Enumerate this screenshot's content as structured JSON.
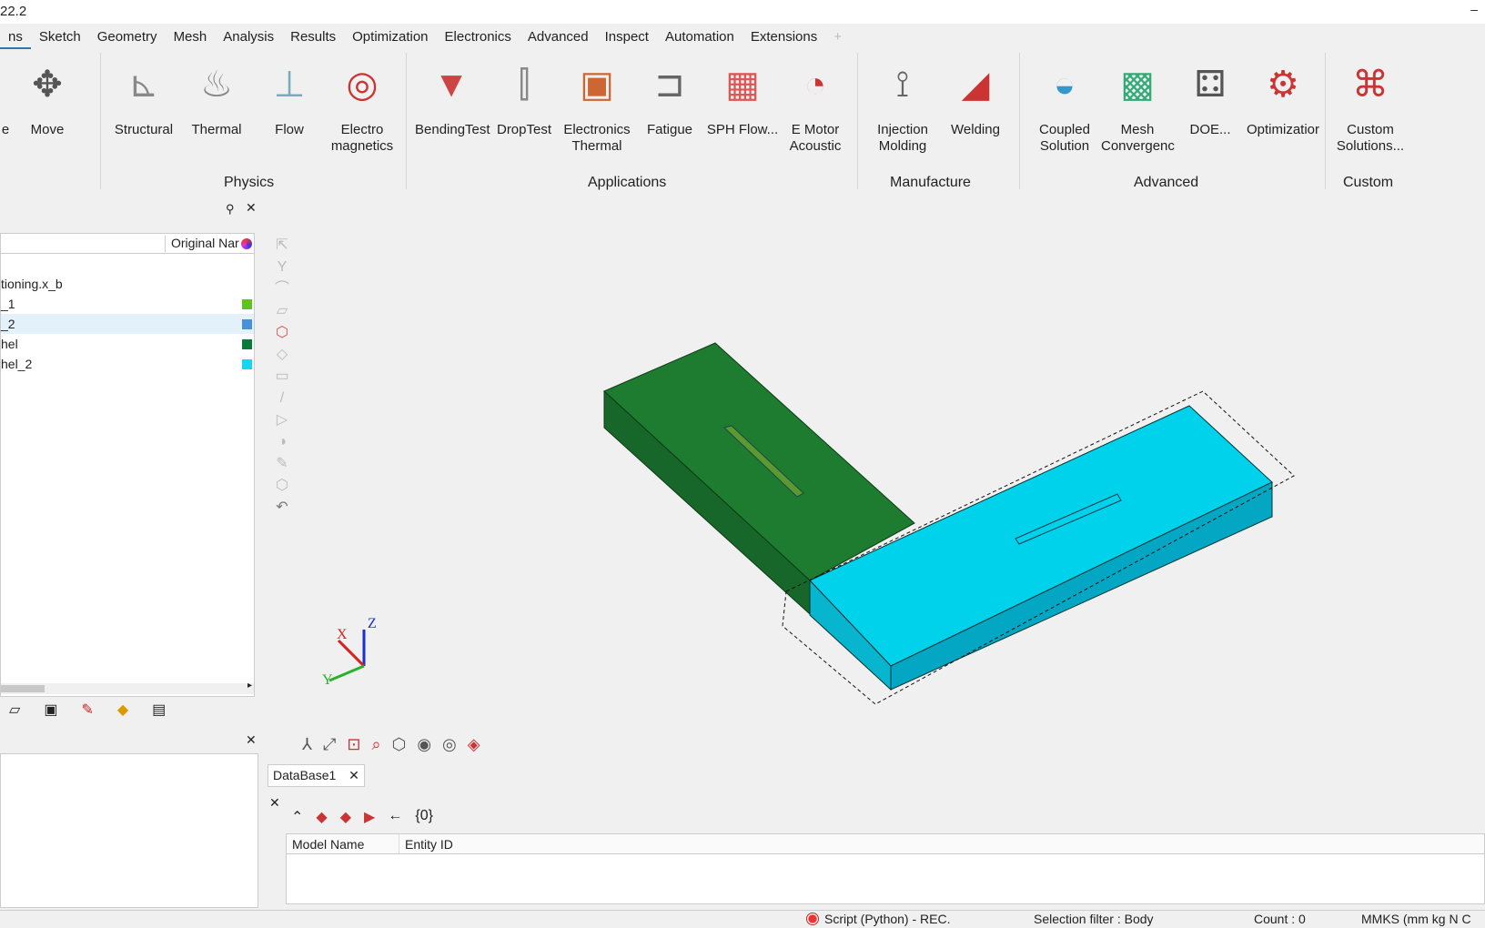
{
  "title": "22.2",
  "menu": [
    "ns",
    "Sketch",
    "Geometry",
    "Mesh",
    "Analysis",
    "Results",
    "Optimization",
    "Electronics",
    "Advanced",
    "Inspect",
    "Automation",
    "Extensions",
    "+"
  ],
  "ribbon": {
    "tools": [
      {
        "label": "e",
        "icon": "partial-icon"
      },
      {
        "label": "Move",
        "icon": "move-icon"
      },
      {
        "label": "Structural",
        "icon": "structural-icon"
      },
      {
        "label": "Thermal",
        "icon": "thermal-icon"
      },
      {
        "label": "Flow",
        "icon": "flow-icon"
      },
      {
        "label": "Electro magnetics",
        "icon": "electromagnetics-icon"
      },
      {
        "label": "BendingTest",
        "icon": "bending-test-icon"
      },
      {
        "label": "DropTest",
        "icon": "drop-test-icon"
      },
      {
        "label": "Electronics Thermal",
        "icon": "electronics-thermal-icon"
      },
      {
        "label": "Fatigue",
        "icon": "fatigue-icon"
      },
      {
        "label": "SPH Flow...",
        "icon": "sph-flow-icon"
      },
      {
        "label": "E Motor Acoustic",
        "icon": "e-motor-acoustic-icon"
      },
      {
        "label": "Injection Molding",
        "icon": "injection-molding-icon"
      },
      {
        "label": "Welding",
        "icon": "welding-icon"
      },
      {
        "label": "Coupled Solution",
        "icon": "coupled-solution-icon"
      },
      {
        "label": "Mesh Convergenc",
        "icon": "mesh-convergence-icon"
      },
      {
        "label": "DOE...",
        "icon": "doe-icon"
      },
      {
        "label": "Optimizatior",
        "icon": "optimization-icon"
      },
      {
        "label": "Custom Solutions...",
        "icon": "custom-solutions-icon"
      }
    ],
    "groups": [
      "Physics",
      "Applications",
      "Manufacture",
      "Advanced",
      "Custom"
    ]
  },
  "tree": {
    "column": "Original Nar",
    "rows": [
      {
        "label": "tioning.x_b",
        "color": ""
      },
      {
        "label": "_1",
        "color": "#5ec41c"
      },
      {
        "label": "_2",
        "color": "#4a90d9",
        "selected": true
      },
      {
        "label": "hel",
        "color": "#0a7a3a"
      },
      {
        "label": "hel_2",
        "color": "#10d8f0"
      }
    ]
  },
  "axes": {
    "x": "X",
    "y": "Y",
    "z": "Z"
  },
  "bottom": {
    "tab": "DataBase1",
    "selection_count": "{0}",
    "columns": [
      "Model Name",
      "Entity ID"
    ]
  },
  "status": {
    "script": "Script (Python) - REC.",
    "filter": "Selection filter : Body",
    "count": "Count : 0",
    "units": "MMKS (mm kg N C"
  },
  "colors": {
    "green_body": "#1b7a2e",
    "cyan_body": "#00d0ea",
    "rec": "#e53030"
  }
}
